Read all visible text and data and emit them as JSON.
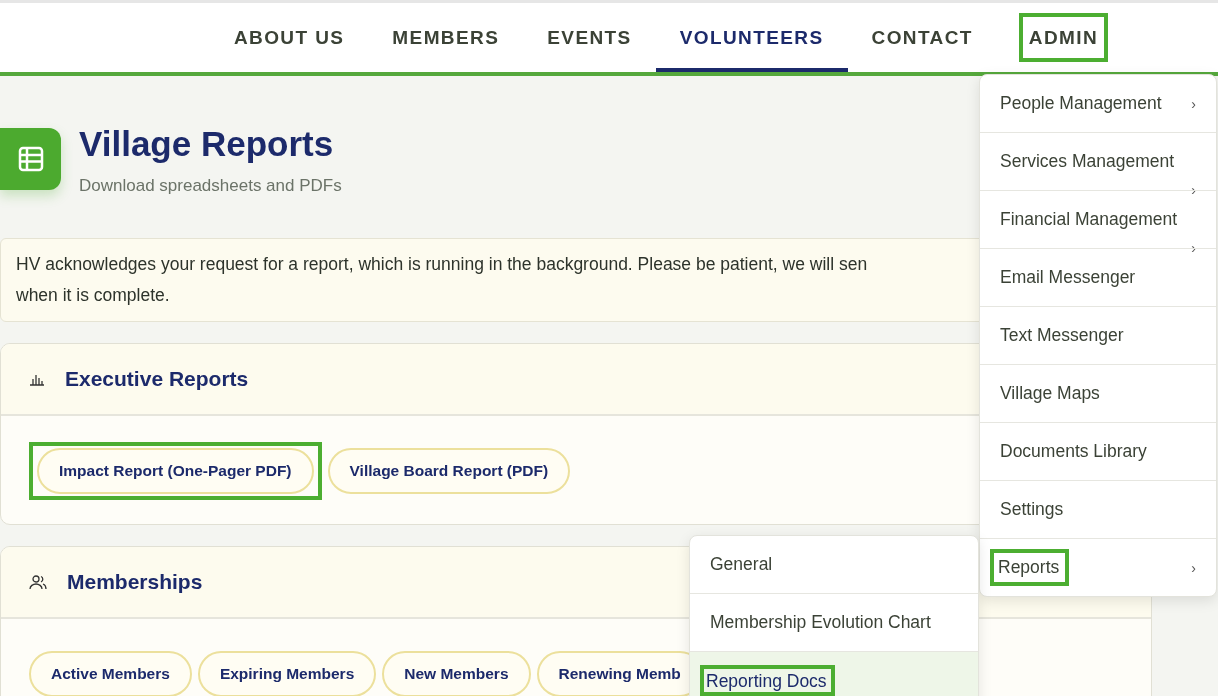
{
  "nav": [
    {
      "label": "ABOUT US",
      "selected": false,
      "highlighted": false
    },
    {
      "label": "MEMBERS",
      "selected": false,
      "highlighted": false
    },
    {
      "label": "EVENTS",
      "selected": false,
      "highlighted": false
    },
    {
      "label": "VOLUNTEERS",
      "selected": true,
      "highlighted": false
    },
    {
      "label": "CONTACT",
      "selected": false,
      "highlighted": false
    },
    {
      "label": "ADMIN",
      "selected": false,
      "highlighted": true
    }
  ],
  "header": {
    "title": "Village Reports",
    "subtitle": "Download spreadsheets and PDFs"
  },
  "alert": {
    "lines": [
      "HV acknowledges your request for a report, which is running in the background. Please be patient, we will sen",
      "when it is complete."
    ]
  },
  "sections": [
    {
      "title": "Executive Reports",
      "kind": "chart",
      "buttons": [
        {
          "label": "Impact Report (One-Pager PDF)",
          "highlighted": true
        },
        {
          "label": "Village Board Report (PDF)",
          "highlighted": false
        }
      ]
    },
    {
      "title": "Memberships",
      "kind": "people",
      "buttons": [
        {
          "label": "Active Members",
          "highlighted": false
        },
        {
          "label": "Expiring Members",
          "highlighted": false
        },
        {
          "label": "New Members",
          "highlighted": false
        },
        {
          "label": "Renewing Memb",
          "highlighted": false
        }
      ]
    }
  ],
  "admin_menu": {
    "items": [
      {
        "label": "People Management",
        "chevron": "›",
        "highlighted": false
      },
      {
        "label": "Services Management",
        "chevron": "›",
        "highlighted": false
      },
      {
        "label": "Financial Management",
        "chevron": "›",
        "highlighted": false
      },
      {
        "label": "Email Messenger",
        "highlighted": false
      },
      {
        "label": "Text Messenger",
        "highlighted": false
      },
      {
        "label": "Village Maps",
        "highlighted": false
      },
      {
        "label": "Documents Library",
        "highlighted": false
      },
      {
        "label": "Settings",
        "highlighted": false
      },
      {
        "label": "Reports",
        "chevron": "›",
        "highlighted": true
      }
    ]
  },
  "reports_submenu": {
    "items": [
      {
        "label": "General",
        "selected": false,
        "highlighted": false
      },
      {
        "label": "Membership Evolution Chart",
        "selected": false,
        "highlighted": false
      },
      {
        "label": "Reporting Docs",
        "selected": true,
        "highlighted": true
      }
    ]
  }
}
